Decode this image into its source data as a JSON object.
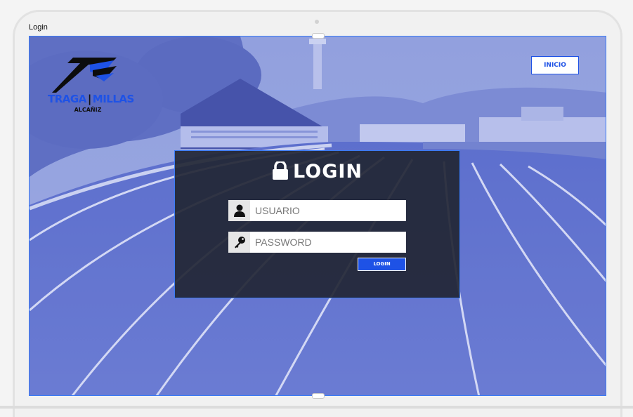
{
  "canvas": {
    "label": "Login"
  },
  "header": {
    "logo": {
      "title_left": "TRAGA",
      "separator": "|",
      "title_right": "MILLAS",
      "subtitle": "ALCAÑIZ"
    },
    "inicio_label": "INICIO"
  },
  "login": {
    "title": "LOGIN",
    "username": {
      "placeholder": "USUARIO",
      "value": ""
    },
    "password": {
      "placeholder": "PASSWORD",
      "value": ""
    },
    "submit_label": "LOGIN"
  },
  "colors": {
    "accent": "#1e52e6",
    "panel": "#222634",
    "overlay": "#8a99d8"
  },
  "icons": {
    "title": "lock-icon",
    "username": "user-icon",
    "password": "key-icon"
  }
}
